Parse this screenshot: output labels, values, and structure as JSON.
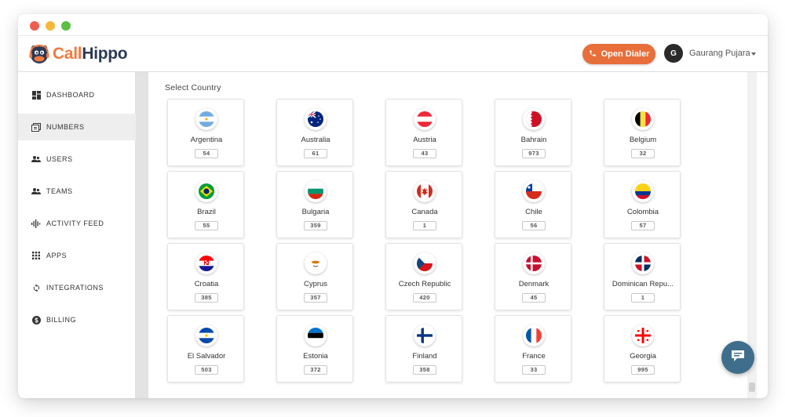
{
  "app": {
    "brand_part1": "Call",
    "brand_part2": "Hippo"
  },
  "header": {
    "dialer_label": "Open Dialer",
    "avatar_initial": "G",
    "user_name": "Gaurang Pujara"
  },
  "sidebar": {
    "items": [
      {
        "label": "DASHBOARD",
        "icon": "dashboard-icon"
      },
      {
        "label": "NUMBERS",
        "icon": "numbers-icon",
        "active": true
      },
      {
        "label": "USERS",
        "icon": "users-icon"
      },
      {
        "label": "TEAMS",
        "icon": "teams-icon"
      },
      {
        "label": "ACTIVITY FEED",
        "icon": "activity-feed-icon"
      },
      {
        "label": "APPS",
        "icon": "apps-icon"
      },
      {
        "label": "INTEGRATIONS",
        "icon": "integrations-icon"
      },
      {
        "label": "BILLING",
        "icon": "billing-icon"
      }
    ]
  },
  "main": {
    "section_title": "Select Country",
    "countries": [
      {
        "name": "Argentina",
        "count": "54",
        "flag": "argentina-flag-icon"
      },
      {
        "name": "Australia",
        "count": "61",
        "flag": "australia-flag-icon"
      },
      {
        "name": "Austria",
        "count": "43",
        "flag": "austria-flag-icon"
      },
      {
        "name": "Bahrain",
        "count": "973",
        "flag": "bahrain-flag-icon"
      },
      {
        "name": "Belgium",
        "count": "32",
        "flag": "belgium-flag-icon"
      },
      {
        "name": "Brazil",
        "count": "55",
        "flag": "brazil-flag-icon"
      },
      {
        "name": "Bulgaria",
        "count": "359",
        "flag": "bulgaria-flag-icon"
      },
      {
        "name": "Canada",
        "count": "1",
        "flag": "canada-flag-icon"
      },
      {
        "name": "Chile",
        "count": "56",
        "flag": "chile-flag-icon"
      },
      {
        "name": "Colombia",
        "count": "57",
        "flag": "colombia-flag-icon"
      },
      {
        "name": "Croatia",
        "count": "385",
        "flag": "croatia-flag-icon"
      },
      {
        "name": "Cyprus",
        "count": "357",
        "flag": "cyprus-flag-icon"
      },
      {
        "name": "Czech Republic",
        "count": "420",
        "flag": "czech-republic-flag-icon"
      },
      {
        "name": "Denmark",
        "count": "45",
        "flag": "denmark-flag-icon"
      },
      {
        "name": "Dominican Repu...",
        "count": "1",
        "flag": "dominican-republic-flag-icon"
      },
      {
        "name": "El Salvador",
        "count": "503",
        "flag": "el-salvador-flag-icon"
      },
      {
        "name": "Estonia",
        "count": "372",
        "flag": "estonia-flag-icon"
      },
      {
        "name": "Finland",
        "count": "358",
        "flag": "finland-flag-icon"
      },
      {
        "name": "France",
        "count": "33",
        "flag": "france-flag-icon"
      },
      {
        "name": "Georgia",
        "count": "995",
        "flag": "georgia-flag-icon"
      }
    ]
  },
  "colors": {
    "brand_orange": "#e86e3a",
    "brand_navy": "#2b3a55",
    "chat_fab": "#3e6e8c"
  }
}
